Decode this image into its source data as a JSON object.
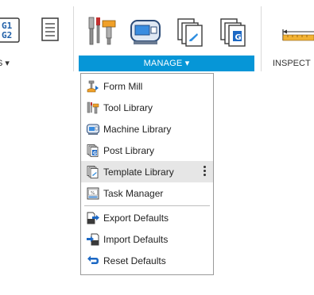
{
  "toolbar": {
    "left_group_label": "S ▾",
    "manage_label": "MANAGE ▾",
    "inspect_label": "INSPECT",
    "g1g2_text_1": "G1",
    "g1g2_text_2": "G2"
  },
  "menu": {
    "items": [
      {
        "label": "Form Mill",
        "icon": "form-mill-icon"
      },
      {
        "label": "Tool Library",
        "icon": "tool-library-icon"
      },
      {
        "label": "Machine Library",
        "icon": "machine-library-icon"
      },
      {
        "label": "Post Library",
        "icon": "post-library-icon"
      },
      {
        "label": "Template Library",
        "icon": "template-library-icon"
      },
      {
        "label": "Task Manager",
        "icon": "task-manager-icon"
      },
      {
        "label": "Export Defaults",
        "icon": "export-defaults-icon"
      },
      {
        "label": "Import Defaults",
        "icon": "import-defaults-icon"
      },
      {
        "label": "Reset Defaults",
        "icon": "reset-defaults-icon"
      }
    ]
  },
  "colors": {
    "accent": "#0696d7",
    "highlight": "#e6e6e6"
  }
}
